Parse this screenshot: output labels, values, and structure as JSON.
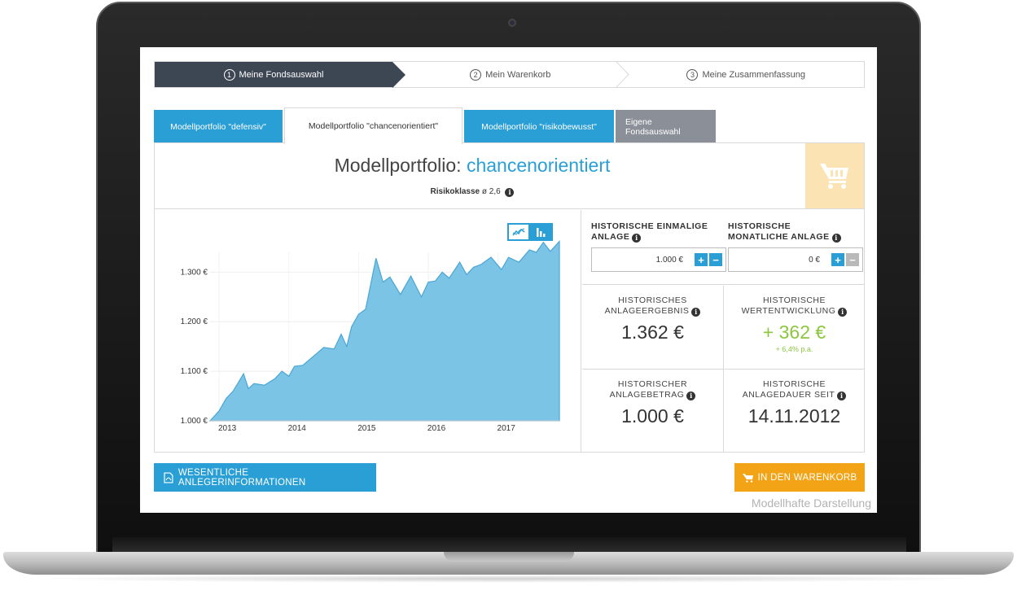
{
  "stepper": {
    "steps": [
      {
        "num": "1",
        "label": "Meine Fondsauswahl"
      },
      {
        "num": "2",
        "label": "Mein Warenkorb"
      },
      {
        "num": "3",
        "label": "Meine Zusammenfassung"
      }
    ]
  },
  "tabs": [
    {
      "label": "Modellportfolio \"defensiv\""
    },
    {
      "label": "Modellportfolio \"chancenorientiert\""
    },
    {
      "label": "Modellportfolio \"risikobewusst\""
    },
    {
      "label": "Eigene Fondsauswahl"
    }
  ],
  "header": {
    "title_prefix": "Modellportfolio: ",
    "title_accent": "chancenorientiert",
    "risk_label": "Risikoklasse",
    "risk_value": "ø 2,6"
  },
  "inputs": {
    "one_time": {
      "label_line1": "HISTORISCHE EINMALIGE",
      "label_line2": "ANLAGE",
      "value": "1.000 €"
    },
    "monthly": {
      "label_line1": "HISTORISCHE",
      "label_line2": "MONATLICHE ANLAGE",
      "value": "0 €"
    }
  },
  "stats": {
    "result": {
      "line1": "HISTORISCHES",
      "line2": "ANLAGEERGEBNIS",
      "value": "1.362 €"
    },
    "growth": {
      "line1": "HISTORISCHE",
      "line2": "WERTENTWICKLUNG",
      "value": "+ 362 €",
      "sub": "+ 6,4% p.a."
    },
    "amount": {
      "line1": "HISTORISCHER",
      "line2": "ANLAGEBETRAG",
      "value": "1.000 €"
    },
    "duration": {
      "line1": "HISTORISCHE",
      "line2": "ANLAGEDAUER SEIT",
      "value": "14.11.2012"
    }
  },
  "buttons": {
    "info_label": "WESENTLICHE ANLEGERINFORMATIONEN",
    "cart_label": "IN DEN WARENKORB"
  },
  "note": "Modellhafte Darstellung",
  "colors": {
    "accent_blue": "#2a9fd6",
    "dark_step": "#3d4653",
    "tab_gray": "#8a8f98",
    "cart_orange": "#f2a416",
    "cart_bg": "#fbe3b3",
    "positive_green": "#8cc63f",
    "area_fill": "#7cc4e6"
  },
  "icons": {
    "info": "info-icon",
    "cart": "shopping-cart-icon",
    "pdf": "pdf-document-icon",
    "line_chart": "line-chart-icon",
    "bar_chart": "bar-chart-icon"
  },
  "chart_data": {
    "type": "area",
    "title": "",
    "xlabel": "",
    "ylabel": "",
    "x_ticks": [
      "2013",
      "2014",
      "2015",
      "2016",
      "2017"
    ],
    "y_ticks": [
      "1.000 €",
      "1.100 €",
      "1.200 €",
      "1.300 €"
    ],
    "y_tick_values": [
      1000,
      1100,
      1200,
      1300
    ],
    "ylim": [
      1000,
      1340
    ],
    "xlim": [
      2012.87,
      2017.88
    ],
    "grid": true,
    "series": [
      {
        "x": [
          2012.87,
          2013.0,
          2013.1,
          2013.2,
          2013.35,
          2013.42,
          2013.5,
          2013.65,
          2013.8,
          2013.9,
          2014.0,
          2014.08,
          2014.2,
          2014.35,
          2014.5,
          2014.65,
          2014.75,
          2014.83,
          2014.9,
          2015.0,
          2015.1,
          2015.25,
          2015.35,
          2015.45,
          2015.6,
          2015.75,
          2015.9,
          2016.0,
          2016.1,
          2016.2,
          2016.3,
          2016.45,
          2016.55,
          2016.65,
          2016.75,
          2016.9,
          2017.05,
          2017.15,
          2017.3,
          2017.45,
          2017.55,
          2017.65,
          2017.75,
          2017.88
        ],
        "values": [
          1000,
          1020,
          1045,
          1060,
          1095,
          1065,
          1075,
          1072,
          1085,
          1100,
          1090,
          1110,
          1112,
          1130,
          1148,
          1145,
          1175,
          1150,
          1190,
          1215,
          1225,
          1328,
          1280,
          1290,
          1255,
          1292,
          1250,
          1280,
          1282,
          1300,
          1288,
          1320,
          1295,
          1310,
          1315,
          1330,
          1305,
          1330,
          1320,
          1345,
          1340,
          1360,
          1342,
          1362
        ]
      }
    ]
  }
}
